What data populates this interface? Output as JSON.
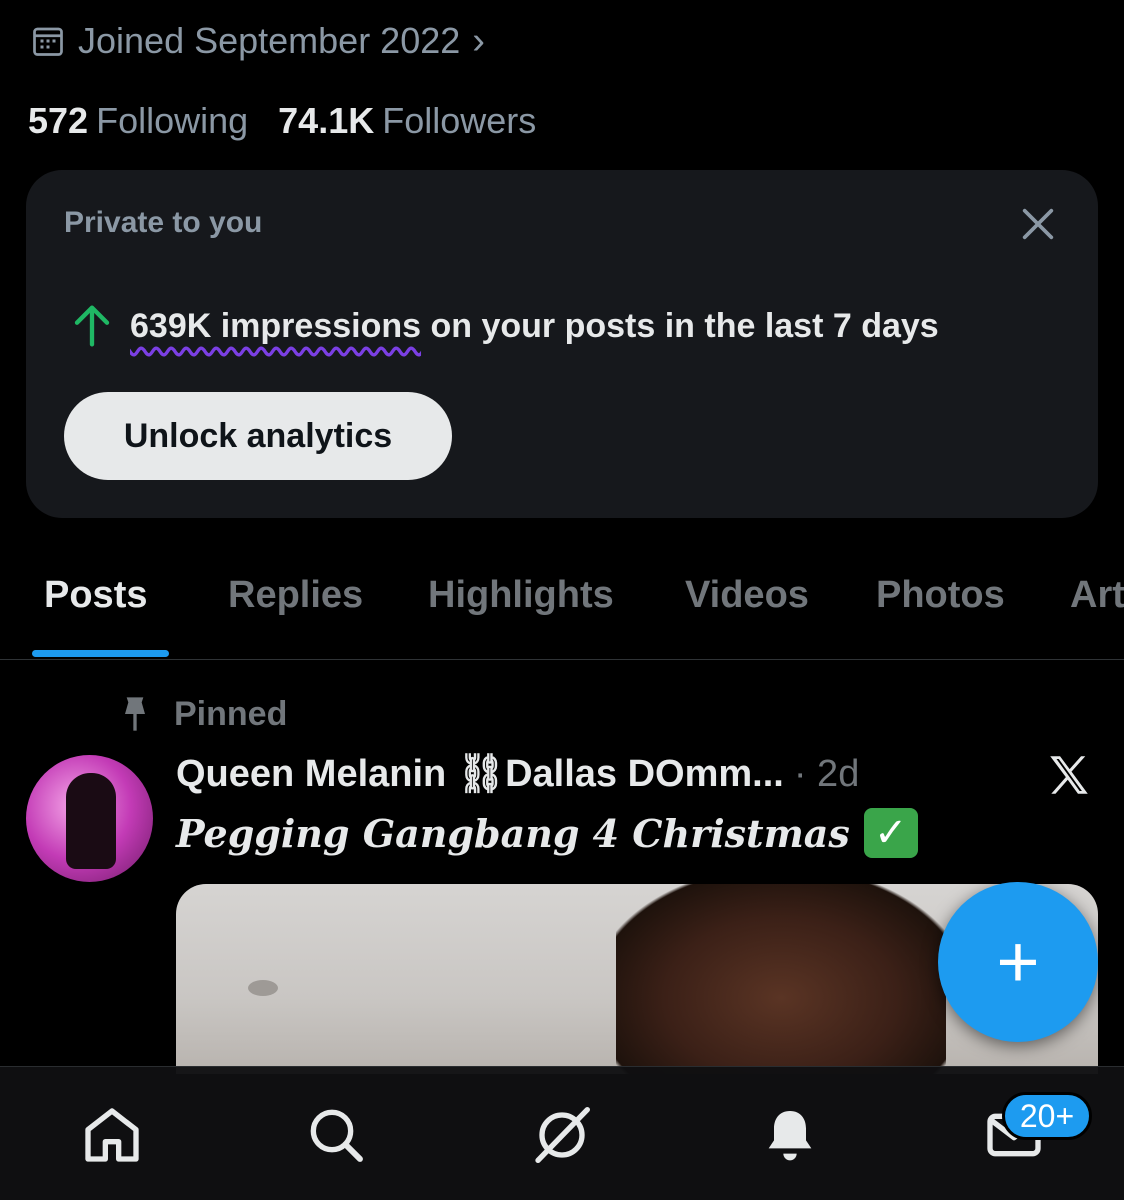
{
  "profile": {
    "joined_text": "Joined September 2022",
    "following_count": "572",
    "following_label": "Following",
    "followers_count": "74.1K",
    "followers_label": "Followers"
  },
  "analytics_card": {
    "label": "Private to you",
    "impressions_prefix": "639K impressions",
    "impressions_suffix": " on your posts in the last 7 days",
    "button_label": "Unlock analytics",
    "trend_color": "#1fb864"
  },
  "tabs": [
    {
      "label": "Posts",
      "active": true
    },
    {
      "label": "Replies",
      "active": false
    },
    {
      "label": "Highlights",
      "active": false
    },
    {
      "label": "Videos",
      "active": false
    },
    {
      "label": "Photos",
      "active": false
    },
    {
      "label": "Art",
      "active": false
    }
  ],
  "post": {
    "pinned_label": "Pinned",
    "author_name": "Queen Melanin ⛓Dallas DOmm...",
    "time": "· 2d",
    "text": "Pegging Gangbang 4 Christmas",
    "check_emoji": "✓"
  },
  "fab": {
    "label": "+"
  },
  "bottom_nav": {
    "items": [
      "home-icon",
      "search-icon",
      "grok-icon",
      "notifications-icon",
      "messages-icon"
    ],
    "messages_badge": "20+"
  },
  "colors": {
    "accent": "#1d9bf0",
    "background": "#000000",
    "muted": "#71767b"
  }
}
